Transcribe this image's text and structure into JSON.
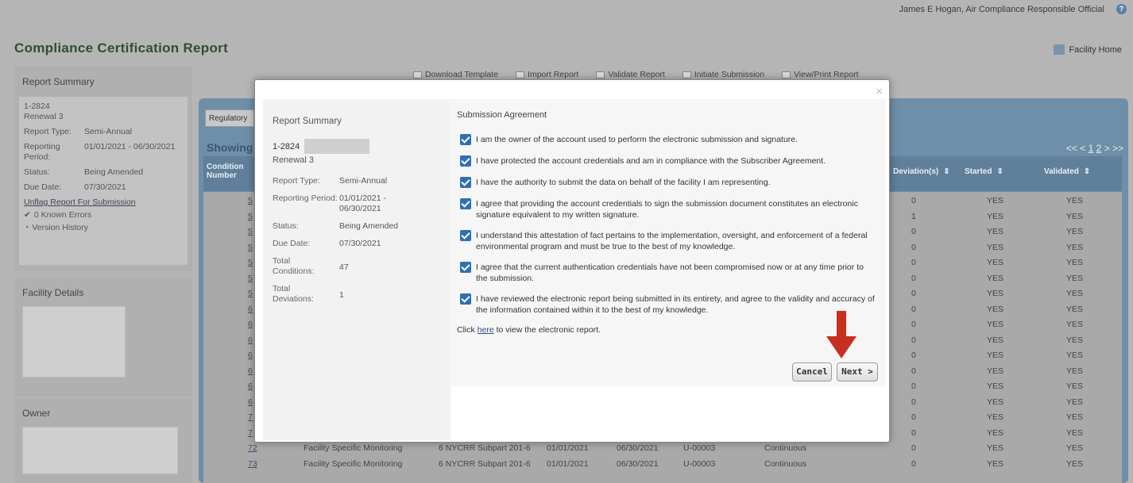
{
  "header": {
    "user": "James E Hogan, Air Compliance Responsible Official",
    "help_icon": "help-icon"
  },
  "page": {
    "title": "Compliance Certification Report",
    "facility_home": "Facility Home"
  },
  "toolbar": [
    "Download Template",
    "Import Report",
    "Validate Report",
    "Initiate Submission",
    "View/Print Report"
  ],
  "left_summary": {
    "title": "Report Summary",
    "id": "1-2824",
    "renewal": "Renewal 3",
    "report_type_label": "Report Type:",
    "report_type": "Semi-Annual",
    "reporting_label": "Reporting Period:",
    "reporting_period": "01/01/2021 - 06/30/2021",
    "status_label": "Status:",
    "status": "Being Amended",
    "due_label": "Due Date:",
    "due_date": "07/30/2021",
    "unflag_link": "Unflag Report For Submission",
    "errors": "0 Known Errors",
    "history": "Version History"
  },
  "left_facility": {
    "title": "Facility Details"
  },
  "left_owner": {
    "title": "Owner"
  },
  "grid": {
    "regulatory_button": "Regulatory",
    "showing": "Showing",
    "pager": {
      "prefix": "<< < ",
      "p1": "1",
      "p2": "2",
      "suffix": " > >>"
    },
    "headers": {
      "condition": "Condition Number",
      "deviations": "Deviation(s)",
      "started": "Started",
      "validated": "Validated"
    },
    "rows": [
      {
        "num": "5",
        "dev": "0",
        "started": "YES",
        "validated": "YES"
      },
      {
        "num": "5",
        "dev": "1",
        "started": "YES",
        "validated": "YES"
      },
      {
        "num": "5",
        "dev": "0",
        "started": "YES",
        "validated": "YES"
      },
      {
        "num": "5",
        "dev": "0",
        "started": "YES",
        "validated": "YES"
      },
      {
        "num": "5",
        "dev": "0",
        "started": "YES",
        "validated": "YES"
      },
      {
        "num": "5",
        "dev": "0",
        "started": "YES",
        "validated": "YES"
      },
      {
        "num": "5",
        "dev": "0",
        "started": "YES",
        "validated": "YES"
      },
      {
        "num": "6",
        "dev": "0",
        "started": "YES",
        "validated": "YES"
      },
      {
        "num": "6",
        "dev": "0",
        "started": "YES",
        "validated": "YES"
      },
      {
        "num": "6",
        "dev": "0",
        "started": "YES",
        "validated": "YES"
      },
      {
        "num": "6",
        "dev": "0",
        "started": "YES",
        "validated": "YES"
      },
      {
        "num": "6",
        "dev": "0",
        "started": "YES",
        "validated": "YES"
      },
      {
        "num": "6",
        "dev": "0",
        "started": "YES",
        "validated": "YES"
      },
      {
        "num": "6",
        "dev": "0",
        "started": "YES",
        "validated": "YES"
      },
      {
        "num": "7",
        "dev": "0",
        "started": "YES",
        "validated": "YES"
      },
      {
        "num": "7",
        "dev": "0",
        "started": "YES",
        "validated": "YES"
      },
      {
        "num": "72",
        "cat": "Facility Specific Monitoring",
        "rule": "6 NYCRR Subpart 201-6",
        "start": "01/01/2021",
        "end": "06/30/2021",
        "unit": "U-00003",
        "freq": "Continuous",
        "dev": "0",
        "started": "YES",
        "validated": "YES"
      },
      {
        "num": "73",
        "cat": "Facility Specific Monitoring",
        "rule": "6 NYCRR Subpart 201-6",
        "start": "01/01/2021",
        "end": "06/30/2021",
        "unit": "U-00003",
        "freq": "Continuous",
        "dev": "0",
        "started": "YES",
        "validated": "YES"
      }
    ]
  },
  "dialog": {
    "close": "×",
    "summary": {
      "title": "Report Summary",
      "id": "1-2824",
      "renewal": "Renewal 3",
      "report_type_label": "Report Type:",
      "report_type": "Semi-Annual",
      "reporting_label": "Reporting Period:",
      "reporting_period": "01/01/2021 - 06/30/2021",
      "status_label": "Status:",
      "status": "Being Amended",
      "due_label": "Due Date:",
      "due_date": "07/30/2021",
      "conditions_label": "Total Conditions:",
      "conditions": "47",
      "deviations_label": "Total Deviations:",
      "deviations": "1"
    },
    "agreement_title": "Submission Agreement",
    "statements": [
      "I am the owner of the account used to perform the electronic submission and signature.",
      "I have protected the account credentials and am in compliance with the Subscriber Agreement.",
      "I have the authority to submit the data on behalf of the facility I am representing.",
      "I agree that providing the account credentials to sign the submission document constitutes an electronic signature equivalent to my written signature.",
      "I understand this attestation of fact pertains to the implementation, oversight, and enforcement of a federal environmental program and must be true to the best of my knowledge.",
      "I agree that the current authentication credentials have not been compromised now or at any time prior to the submission.",
      "I have reviewed the electronic report being submitted in its entirety, and agree to the validity and accuracy of the information contained within it to the best of my knowledge."
    ],
    "click_prefix": "Click ",
    "click_link": "here",
    "click_suffix": " to view the electronic report.",
    "cancel": "Cancel",
    "next": "Next >"
  }
}
